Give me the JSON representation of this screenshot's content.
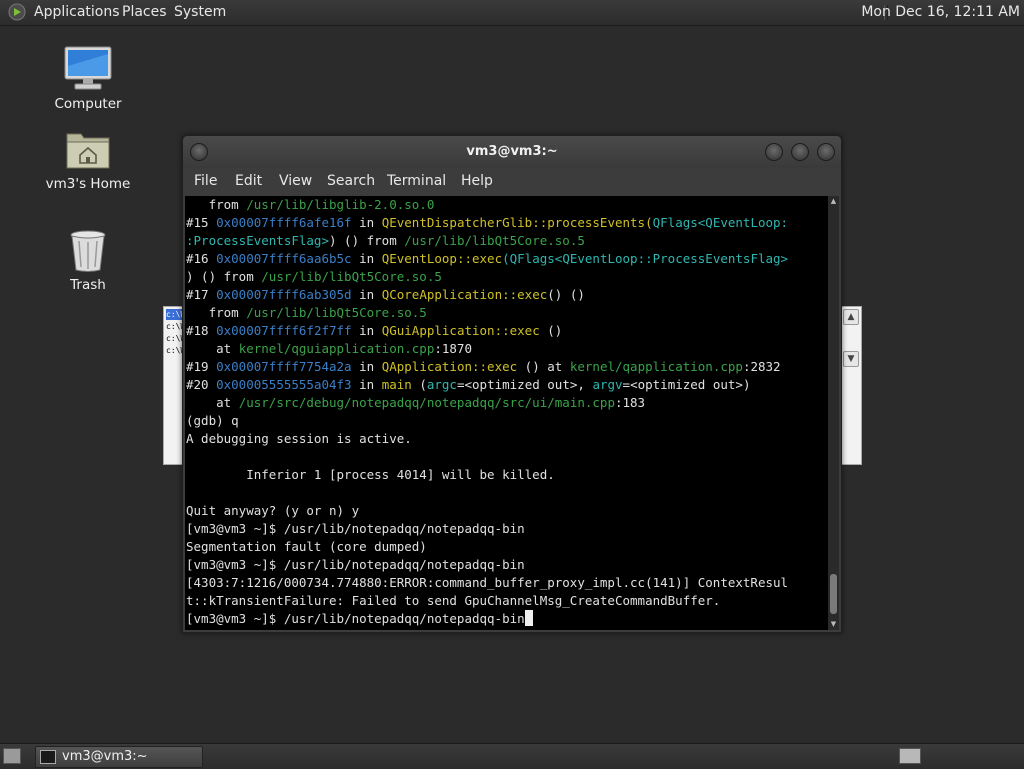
{
  "top_panel": {
    "menus": [
      "Applications",
      "Places",
      "System"
    ],
    "clock": "Mon Dec 16, 12:11 AM"
  },
  "desktop": {
    "icons": [
      {
        "label": "Computer",
        "icon": "computer-icon"
      },
      {
        "label": "vm3's Home",
        "icon": "home-folder-icon"
      },
      {
        "label": "Trash",
        "icon": "trash-icon"
      }
    ]
  },
  "background_window": {
    "lines": [
      "c:\\W",
      "c:\\W",
      "c:\\W",
      "c:\\W"
    ]
  },
  "terminal": {
    "title": "vm3@vm3:~",
    "menu": [
      "File",
      "Edit",
      "View",
      "Search",
      "Terminal",
      "Help"
    ],
    "lines": [
      [
        {
          "t": "   from "
        },
        {
          "t": "/usr/lib/libglib-2.0.so.0",
          "c": "path"
        }
      ],
      [
        {
          "t": "#15 "
        },
        {
          "t": "0x00007ffff6afe16f",
          "c": "addr"
        },
        {
          "t": " in "
        },
        {
          "t": "QEventDispatcherGlib::processEvents",
          "c": "func"
        },
        {
          "t": "(",
          "c": "func"
        },
        {
          "t": "QFlags<QEventLoop:",
          "c": "var"
        }
      ],
      [
        {
          "t": ":ProcessEventsFlag>",
          "c": "var"
        },
        {
          "t": ") () from "
        },
        {
          "t": "/usr/lib/libQt5Core.so.5",
          "c": "path"
        }
      ],
      [
        {
          "t": "#16 "
        },
        {
          "t": "0x00007ffff6aa6b5c",
          "c": "addr"
        },
        {
          "t": " in "
        },
        {
          "t": "QEventLoop::exec",
          "c": "func"
        },
        {
          "t": "(QFlags<QEventLoop::ProcessEventsFlag>",
          "c": "var"
        }
      ],
      [
        {
          "t": ") () from "
        },
        {
          "t": "/usr/lib/libQt5Core.so.5",
          "c": "path"
        }
      ],
      [
        {
          "t": "#17 "
        },
        {
          "t": "0x00007ffff6ab305d",
          "c": "addr"
        },
        {
          "t": " in "
        },
        {
          "t": "QCoreApplication::exec",
          "c": "func"
        },
        {
          "t": "() ()"
        }
      ],
      [
        {
          "t": "   from "
        },
        {
          "t": "/usr/lib/libQt5Core.so.5",
          "c": "path"
        }
      ],
      [
        {
          "t": "#18 "
        },
        {
          "t": "0x00007ffff6f2f7ff",
          "c": "addr"
        },
        {
          "t": " in "
        },
        {
          "t": "QGuiApplication::exec",
          "c": "func"
        },
        {
          "t": " ()"
        }
      ],
      [
        {
          "t": "    at "
        },
        {
          "t": "kernel/qguiapplication.cpp",
          "c": "path"
        },
        {
          "t": ":1870"
        }
      ],
      [
        {
          "t": "#19 "
        },
        {
          "t": "0x00007ffff7754a2a",
          "c": "addr"
        },
        {
          "t": " in "
        },
        {
          "t": "QApplication::exec",
          "c": "func"
        },
        {
          "t": " () at "
        },
        {
          "t": "kernel/qapplication.cpp",
          "c": "path"
        },
        {
          "t": ":2832"
        }
      ],
      [
        {
          "t": "#20 "
        },
        {
          "t": "0x00005555555a04f3",
          "c": "addr"
        },
        {
          "t": " in "
        },
        {
          "t": "main",
          "c": "func"
        },
        {
          "t": " ("
        },
        {
          "t": "argc",
          "c": "var"
        },
        {
          "t": "=<optimized out>, "
        },
        {
          "t": "argv",
          "c": "var"
        },
        {
          "t": "=<optimized out>)"
        }
      ],
      [
        {
          "t": "    at "
        },
        {
          "t": "/usr/src/debug/notepadqq/notepadqq/src/ui/main.cpp",
          "c": "path"
        },
        {
          "t": ":183"
        }
      ],
      [
        {
          "t": "(gdb) q"
        }
      ],
      [
        {
          "t": "A debugging session is active."
        }
      ],
      [
        {
          "t": ""
        }
      ],
      [
        {
          "t": "        Inferior 1 [process 4014] will be killed."
        }
      ],
      [
        {
          "t": ""
        }
      ],
      [
        {
          "t": "Quit anyway? (y or n) y"
        }
      ],
      [
        {
          "t": "[vm3@vm3 ~]$ /usr/lib/notepadqq/notepadqq-bin"
        }
      ],
      [
        {
          "t": "Segmentation fault (core dumped)"
        }
      ],
      [
        {
          "t": "[vm3@vm3 ~]$ /usr/lib/notepadqq/notepadqq-bin"
        }
      ],
      [
        {
          "t": "[4303:7:1216/000734.774880:ERROR:command_buffer_proxy_impl.cc(141)] ContextResul"
        }
      ],
      [
        {
          "t": "t::kTransientFailure: Failed to send GpuChannelMsg_CreateCommandBuffer."
        }
      ],
      [
        {
          "t": "[vm3@vm3 ~]$ /usr/lib/notepadqq/notepadqq-bin"
        },
        {
          "cursor": true
        }
      ]
    ]
  },
  "taskbar": {
    "task_label": "vm3@vm3:~"
  }
}
